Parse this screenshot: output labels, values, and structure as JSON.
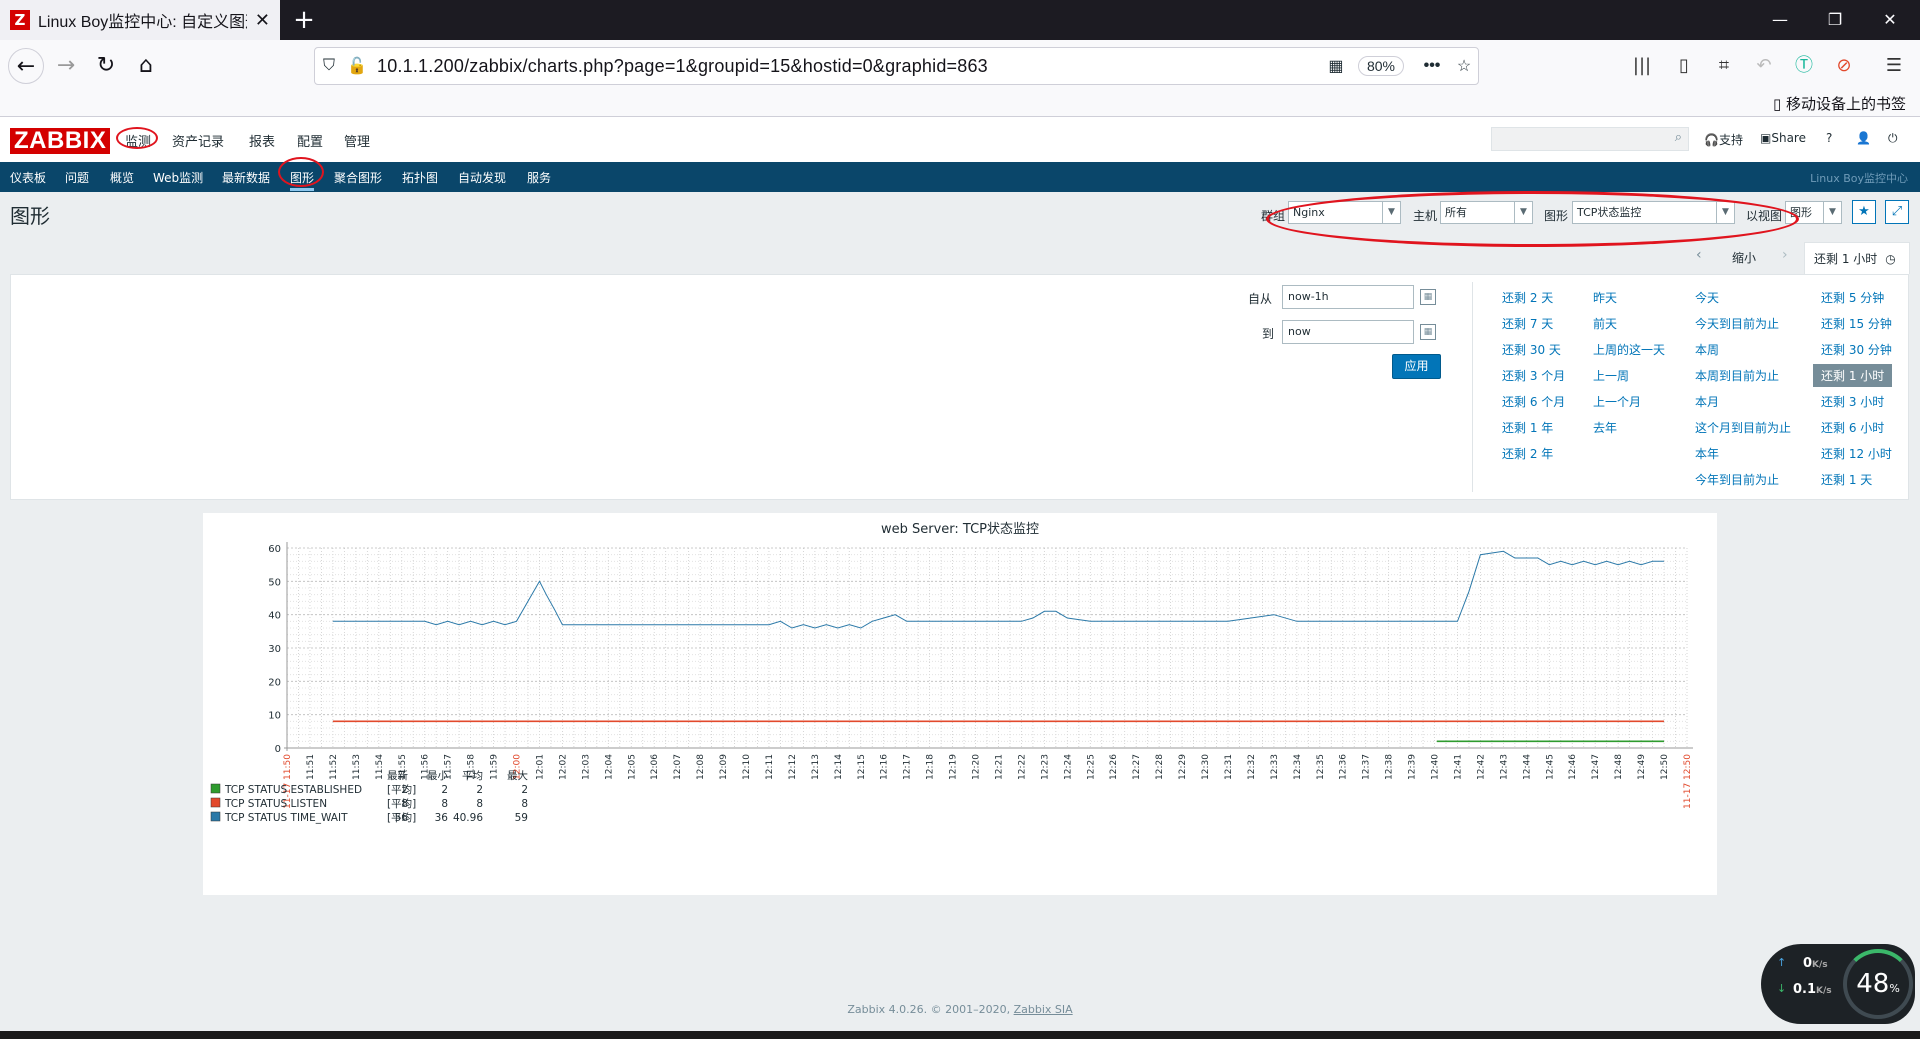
{
  "browser": {
    "tab_title": "Linux Boy监控中心: 自定义图形",
    "url": "10.1.1.200/zabbix/charts.php?page=1&groupid=15&hostid=0&graphid=863",
    "zoom": "80%",
    "mobile_bookmarks": "移动设备上的书签"
  },
  "zabbix": {
    "logo": "ZABBIX",
    "top_menu": [
      "监测",
      "资产记录",
      "报表",
      "配置",
      "管理"
    ],
    "header_links": {
      "support": "支持",
      "share": "Share",
      "help": "?"
    },
    "sub_menu": [
      "仪表板",
      "问题",
      "概览",
      "Web监测",
      "最新数据",
      "图形",
      "聚合图形",
      "拓扑图",
      "自动发现",
      "服务"
    ],
    "server_name": "Linux Boy监控中心",
    "page_title": "图形",
    "filters": {
      "group_label": "群组",
      "group_value": "Nginx",
      "host_label": "主机",
      "host_value": "所有",
      "graph_label": "图形",
      "graph_value": "TCP状态监控",
      "view_label": "以视图",
      "view_value": "图形"
    },
    "time_bar": {
      "zoom_out": "缩小",
      "current": "还剩 1 小时"
    },
    "time_panel": {
      "from_label": "自从",
      "from_value": "now-1h",
      "to_label": "到",
      "to_value": "now",
      "apply": "应用",
      "col1": [
        "还剩 2 天",
        "还剩 7 天",
        "还剩 30 天",
        "还剩 3 个月",
        "还剩 6 个月",
        "还剩 1 年",
        "还剩 2 年"
      ],
      "col2": [
        "昨天",
        "前天",
        "上周的这一天",
        "上一周",
        "上一个月",
        "去年"
      ],
      "col3": [
        "今天",
        "今天到目前为止",
        "本周",
        "本周到目前为止",
        "本月",
        "这个月到目前为止",
        "本年",
        "今年到目前为止"
      ],
      "col4": [
        "还剩 5 分钟",
        "还剩 15 分钟",
        "还剩 30 分钟",
        "还剩 1 小时",
        "还剩 3 小时",
        "还剩 6 小时",
        "还剩 12 小时",
        "还剩 1 天"
      ]
    },
    "footer": {
      "text": "Zabbix 4.0.26. © 2001–2020, ",
      "link": "Zabbix SIA"
    }
  },
  "chart_data": {
    "type": "line",
    "title": "web Server: TCP状态监控",
    "ylim": [
      0,
      60
    ],
    "y_ticks": [
      "60",
      "50",
      "40",
      "30",
      "20",
      "10",
      "0"
    ],
    "x_ticks": [
      "11-17 11:50",
      "11:51",
      "11:52",
      "11:53",
      "11:54",
      "11:55",
      "11:56",
      "11:57",
      "11:58",
      "11:59",
      "12:00",
      "12:01",
      "12:02",
      "12:03",
      "12:04",
      "12:05",
      "12:06",
      "12:07",
      "12:08",
      "12:09",
      "12:10",
      "12:11",
      "12:12",
      "12:13",
      "12:14",
      "12:15",
      "12:16",
      "12:17",
      "12:18",
      "12:19",
      "12:20",
      "12:21",
      "12:22",
      "12:23",
      "12:24",
      "12:25",
      "12:26",
      "12:27",
      "12:28",
      "12:29",
      "12:30",
      "12:31",
      "12:32",
      "12:33",
      "12:34",
      "12:35",
      "12:36",
      "12:37",
      "12:38",
      "12:39",
      "12:40",
      "12:41",
      "12:42",
      "12:43",
      "12:44",
      "12:45",
      "12:46",
      "12:47",
      "12:48",
      "12:49",
      "12:50",
      "11-17 12:50"
    ],
    "legend_headers": [
      "最新",
      "最小",
      "平均",
      "最大"
    ],
    "series": [
      {
        "name": "TCP STATUS ESTABLISHED",
        "func": "[平均]",
        "color": "#2e9b2e",
        "last": "2",
        "min": "2",
        "avg": "2",
        "max": "2",
        "x": [
          50.1,
          60
        ],
        "values": [
          2,
          2
        ]
      },
      {
        "name": "TCP STATUS LISTEN",
        "func": "[平均]",
        "color": "#e2492c",
        "last": "8",
        "min": "8",
        "avg": "8",
        "max": "8",
        "x": [
          2,
          60
        ],
        "values": [
          8,
          8
        ]
      },
      {
        "name": "TCP STATUS TIME_WAIT",
        "func": "[平均]",
        "color": "#2b79a8",
        "last": "56",
        "min": "36",
        "avg": "40.96",
        "max": "59",
        "x": [
          2,
          3,
          4,
          5,
          6,
          6.5,
          7,
          7.5,
          8,
          8.5,
          9,
          9.5,
          10,
          10.5,
          11,
          11.3,
          11.7,
          12,
          12.5,
          13,
          14,
          15,
          16,
          17,
          18,
          19,
          20,
          21,
          21.5,
          22,
          22.5,
          23,
          23.5,
          24,
          24.5,
          25,
          25.5,
          26,
          26.5,
          27,
          27.5,
          28,
          29,
          30,
          31,
          32,
          32.5,
          33,
          33.5,
          34,
          35,
          36,
          37,
          38,
          39,
          39.5,
          40,
          40.5,
          41,
          42,
          43,
          44,
          45,
          46,
          47,
          48,
          49,
          49.5,
          50,
          50.5,
          51,
          51.5,
          52,
          53,
          53.5,
          54,
          54.5,
          55,
          55.5,
          56,
          56.5,
          57,
          57.5,
          58,
          58.5,
          59,
          59.5,
          60
        ],
        "values": [
          38,
          38,
          38,
          38,
          38,
          37,
          38,
          37,
          38,
          37,
          38,
          37,
          38,
          44,
          50,
          46,
          41,
          37,
          37,
          37,
          37,
          37,
          37,
          37,
          37,
          37,
          37,
          37,
          38,
          36,
          37,
          36,
          37,
          36,
          37,
          36,
          38,
          39,
          40,
          38,
          38,
          38,
          38,
          38,
          38,
          38,
          39,
          41,
          41,
          39,
          38,
          38,
          38,
          38,
          38,
          38,
          38,
          38,
          38,
          39,
          40,
          38,
          38,
          38,
          38,
          38,
          38,
          38,
          38,
          38,
          38,
          47,
          58,
          59,
          57,
          57,
          57,
          55,
          56,
          55,
          56,
          55,
          56,
          55,
          56,
          55,
          56,
          56
        ]
      }
    ]
  }
}
